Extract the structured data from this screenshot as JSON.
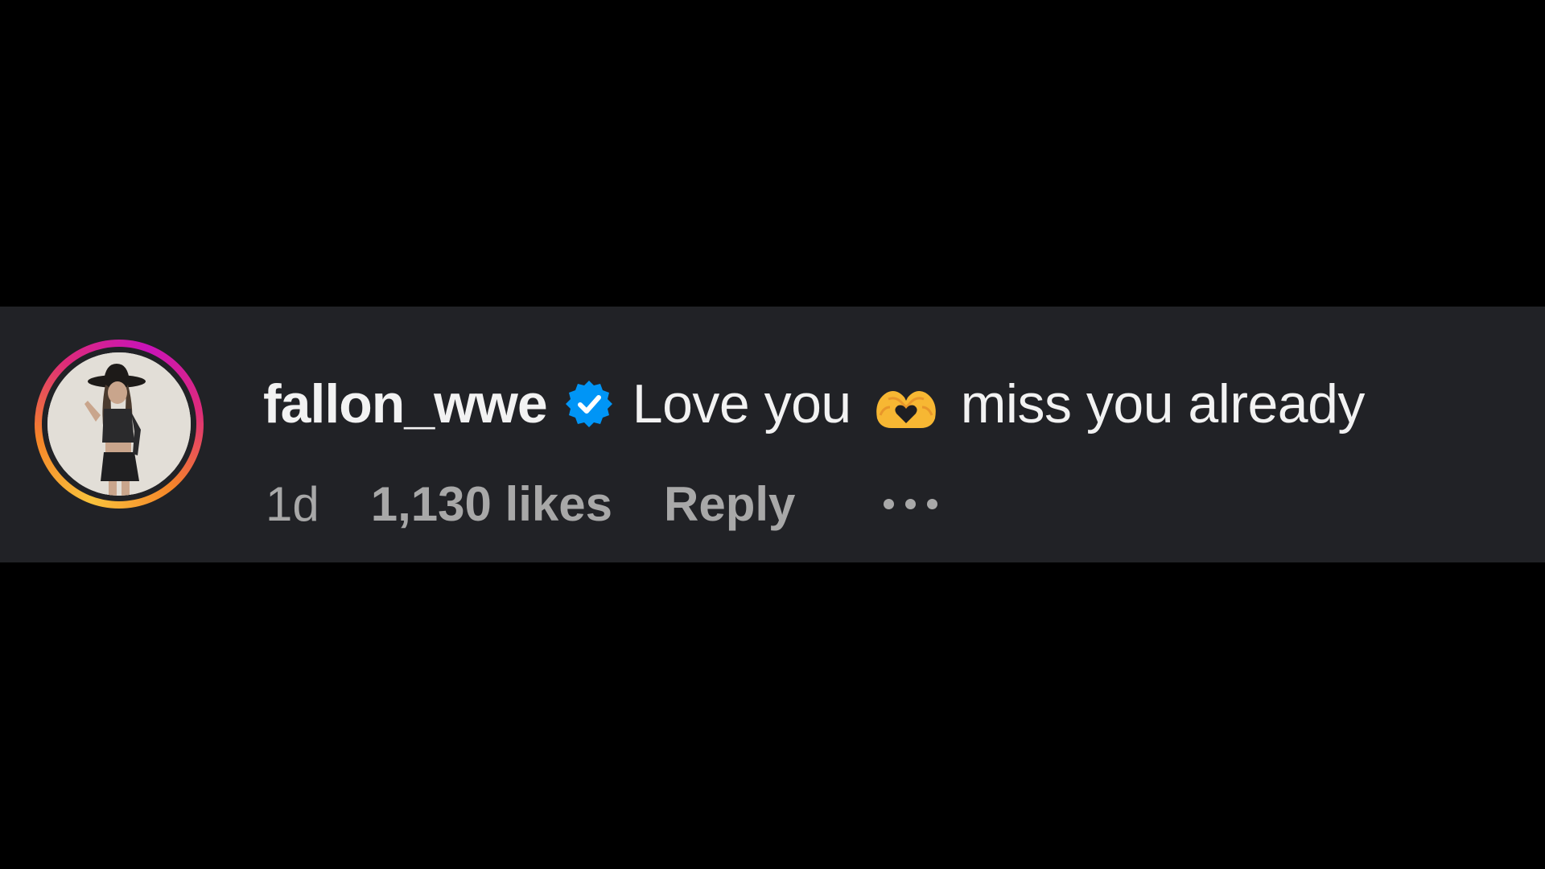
{
  "comment": {
    "username": "fallon_wwe",
    "verified": true,
    "text_before_emoji": "Love you",
    "emoji": "heart-hands-emoji",
    "text_after_emoji": "miss you already",
    "time_ago": "1d",
    "likes": "1,130 likes",
    "reply_label": "Reply",
    "more_icon": "more-options-icon"
  },
  "colors": {
    "background": "#000000",
    "comment_band": "#212226",
    "primary_text": "#f2f2f2",
    "secondary_text": "#a8a8a8",
    "verified_badge": "#0095f6"
  }
}
